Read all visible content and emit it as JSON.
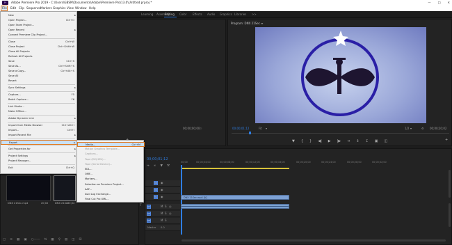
{
  "window": {
    "title": "Adobe Premiere Pro 2019 - C:\\Users\\GBSM\\Documents\\Adobe\\Premiere Pro\\13.0\\Untitled.prproj *",
    "icon_text": "Pr"
  },
  "menubar": [
    "File",
    "Edit",
    "Clip",
    "Sequence",
    "Markers",
    "Graphics",
    "View",
    "Window",
    "Help"
  ],
  "workspaces": [
    "Learning",
    "Assembly",
    "Editing",
    "Color",
    "Effects",
    "Audio",
    "Graphics",
    "Libraries",
    ">>"
  ],
  "file_menu": [
    {
      "label": "New",
      "shortcut": "",
      "submenu": true
    },
    {
      "label": "Open Project...",
      "shortcut": "Ctrl+O"
    },
    {
      "label": "Open Team Project...",
      "shortcut": ""
    },
    {
      "label": "Open Recent",
      "shortcut": "",
      "submenu": true
    },
    {
      "label": "Convert Premiere Clip Project...",
      "shortcut": ""
    },
    {
      "sep": true
    },
    {
      "label": "Close",
      "shortcut": "Ctrl+W"
    },
    {
      "label": "Close Project",
      "shortcut": "Ctrl+Shift+W"
    },
    {
      "label": "Close All Projects",
      "shortcut": ""
    },
    {
      "label": "Refresh All Projects",
      "shortcut": ""
    },
    {
      "label": "Save",
      "shortcut": "Ctrl+S"
    },
    {
      "label": "Save As...",
      "shortcut": "Ctrl+Shift+S"
    },
    {
      "label": "Save a Copy...",
      "shortcut": "Ctrl+Alt+S"
    },
    {
      "label": "Save All",
      "shortcut": ""
    },
    {
      "label": "Revert",
      "shortcut": ""
    },
    {
      "sep": true
    },
    {
      "label": "Sync Settings",
      "shortcut": "",
      "submenu": true
    },
    {
      "sep": true
    },
    {
      "label": "Capture...",
      "shortcut": "F5"
    },
    {
      "label": "Batch Capture...",
      "shortcut": "F6"
    },
    {
      "sep": true
    },
    {
      "label": "Link Media...",
      "shortcut": ""
    },
    {
      "label": "Make Offline...",
      "shortcut": ""
    },
    {
      "sep": true
    },
    {
      "label": "Adobe Dynamic Link",
      "shortcut": "",
      "submenu": true
    },
    {
      "sep": true
    },
    {
      "label": "Import from Media Browser",
      "shortcut": "Ctrl+Alt+I"
    },
    {
      "label": "Import...",
      "shortcut": "Ctrl+I"
    },
    {
      "label": "Import Recent File",
      "shortcut": "",
      "submenu": true
    },
    {
      "sep": true
    },
    {
      "label": "Export",
      "shortcut": "",
      "submenu": true,
      "highlighted": true
    },
    {
      "sep": true
    },
    {
      "label": "Get Properties for",
      "shortcut": "",
      "submenu": true
    },
    {
      "sep": true
    },
    {
      "label": "Project Settings",
      "shortcut": "",
      "submenu": true
    },
    {
      "label": "Project Manager...",
      "shortcut": ""
    },
    {
      "sep": true
    },
    {
      "label": "Exit",
      "shortcut": "Ctrl+Q"
    }
  ],
  "export_submenu": [
    {
      "label": "Media...",
      "shortcut": "Ctrl+M",
      "highlighted": true
    },
    {
      "label": "Motion Graphics Template...",
      "shortcut": "",
      "dim": true
    },
    {
      "label": "Captions...",
      "shortcut": "",
      "dim": true
    },
    {
      "label": "Tape (DV/HDV)...",
      "shortcut": "",
      "dim": true
    },
    {
      "label": "Tape (Serial Device)...",
      "shortcut": "",
      "dim": true
    },
    {
      "label": "EDL...",
      "shortcut": ""
    },
    {
      "label": "OMF...",
      "shortcut": ""
    },
    {
      "label": "Markers...",
      "shortcut": ""
    },
    {
      "label": "Selection as Premiere Project...",
      "shortcut": ""
    },
    {
      "label": "AAF...",
      "shortcut": ""
    },
    {
      "label": "Avid Log Exchange...",
      "shortcut": ""
    },
    {
      "label": "Final Cut Pro XML...",
      "shortcut": ""
    }
  ],
  "source_monitor": {
    "timecode_left": "00;00;00;00",
    "timecode_right": "00;00;00;00"
  },
  "program_monitor": {
    "title": "Program: DNX 21Sec ≡",
    "timecode_left": "00;00;01;12",
    "fit": "Fit",
    "quality": "1/2",
    "timecode_right": "00;00;20;02"
  },
  "project_panel": {
    "items": [
      {
        "label": "DNX 21Sec.mp4",
        "duration": "20;02"
      },
      {
        "label": "DNX 21Sec",
        "duration": "20;02"
      }
    ]
  },
  "timeline": {
    "timecode": "00;00;01;12",
    "ruler": [
      "00;00",
      "00;00;04;00",
      "00;00;08;00",
      "00;00;12;00",
      "00;00;16;00",
      "00;00;20;00",
      "00;00;24;00",
      "00;00;28;00",
      "00;00;32;00"
    ],
    "video_tracks": [
      "V3",
      "V2",
      "V1"
    ],
    "audio_tracks": [
      "A1",
      "A2",
      "A3"
    ],
    "master": "Master",
    "master_value": "0.0",
    "video_clip": "DNX 21Sec.mp4 [V]",
    "audio_clip": ""
  },
  "colors": {
    "accent_blue": "#2f7de1",
    "highlight_orange": "#e07a22",
    "clip_blue": "#7da1d4"
  }
}
